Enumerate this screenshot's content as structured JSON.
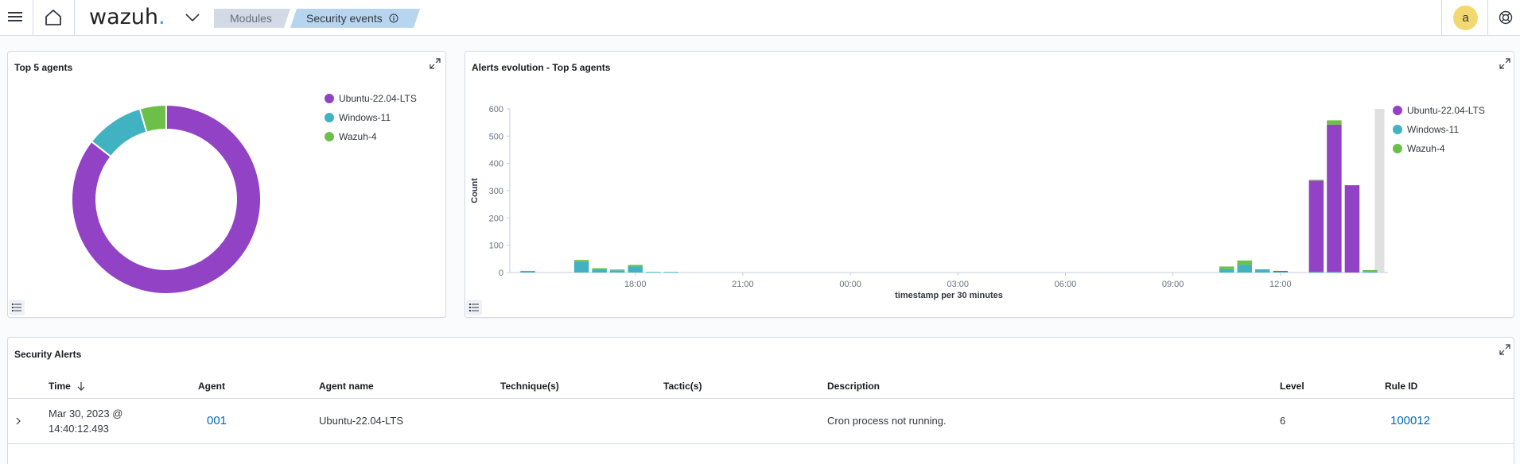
{
  "header": {
    "logo_text": "wazuh",
    "logo_dot": ".",
    "breadcrumb_modules": "Modules",
    "breadcrumb_current": "Security events",
    "avatar_initial": "a"
  },
  "colors": {
    "ubuntu": "#9242c4",
    "windows": "#40b2c2",
    "wazuh": "#6cc04a"
  },
  "top_agents": {
    "title": "Top 5 agents",
    "legend": [
      "Ubuntu-22.04-LTS",
      "Windows-11",
      "Wazuh-4"
    ]
  },
  "alerts_evolution": {
    "title": "Alerts evolution - Top 5 agents",
    "legend": [
      "Ubuntu-22.04-LTS",
      "Windows-11",
      "Wazuh-4"
    ]
  },
  "chart_data": [
    {
      "type": "pie",
      "title": "Top 5 agents",
      "donut": true,
      "labels": [
        "Ubuntu-22.04-LTS",
        "Windows-11",
        "Wazuh-4"
      ],
      "values": [
        85.5,
        10,
        4.5
      ],
      "legend": "top-right"
    },
    {
      "type": "bar",
      "stacked": true,
      "title": "Alerts evolution - Top 5 agents",
      "xlabel": "timestamp per 30 minutes",
      "ylabel": "Count",
      "ylim": [
        0,
        600
      ],
      "yticks": [
        0,
        100,
        200,
        300,
        400,
        500,
        600
      ],
      "xtick_labels": [
        "18:00",
        "21:00",
        "00:00",
        "03:00",
        "06:00",
        "09:00",
        "12:00"
      ],
      "xtick_hours": [
        18,
        21,
        24,
        27,
        30,
        33,
        36
      ],
      "x_hours": [
        15.0,
        15.5,
        16.0,
        16.5,
        17.0,
        17.5,
        18.0,
        18.5,
        19.0,
        19.5,
        20.0,
        20.5,
        21.0,
        21.5,
        22.0,
        22.5,
        23.0,
        23.5,
        24.0,
        24.5,
        25.0,
        25.5,
        26.0,
        26.5,
        27.0,
        27.5,
        28.0,
        28.5,
        29.0,
        29.5,
        30.0,
        30.5,
        31.0,
        31.5,
        32.0,
        32.5,
        33.0,
        33.5,
        34.0,
        34.5,
        35.0,
        35.5,
        36.0,
        36.5,
        37.0,
        37.5,
        38.0,
        38.5
      ],
      "series": [
        {
          "name": "Ubuntu-22.04-LTS",
          "values": [
            0,
            0,
            0,
            0,
            0,
            0,
            0,
            0,
            0,
            0,
            0,
            0,
            0,
            0,
            0,
            0,
            0,
            0,
            0,
            0,
            0,
            0,
            0,
            0,
            0,
            0,
            0,
            0,
            0,
            0,
            0,
            0,
            0,
            0,
            0,
            0,
            0,
            0,
            0,
            0,
            0,
            0,
            2,
            0,
            335,
            540,
            320,
            0
          ]
        },
        {
          "name": "Windows-11",
          "values": [
            6,
            0,
            0,
            40,
            12,
            8,
            22,
            2,
            2,
            0,
            0,
            0,
            0,
            0,
            0,
            0,
            0,
            0,
            0,
            0,
            0,
            0,
            0,
            0,
            0,
            0,
            0,
            0,
            0,
            0,
            0,
            0,
            0,
            0,
            0,
            0,
            0,
            0,
            0,
            12,
            28,
            10,
            4,
            0,
            2,
            2,
            0,
            5
          ]
        },
        {
          "name": "Wazuh-4",
          "values": [
            0,
            0,
            0,
            6,
            4,
            3,
            6,
            0,
            0,
            0,
            0,
            0,
            0,
            0,
            0,
            0,
            0,
            0,
            0,
            0,
            0,
            0,
            0,
            0,
            0,
            0,
            0,
            0,
            0,
            0,
            0,
            0,
            0,
            0,
            0,
            0,
            0,
            0,
            0,
            10,
            16,
            2,
            0,
            0,
            3,
            16,
            0,
            4
          ]
        }
      ],
      "legend": "right"
    }
  ],
  "security_alerts": {
    "title": "Security Alerts",
    "columns": {
      "time": "Time",
      "agent": "Agent",
      "agent_name": "Agent name",
      "techniques": "Technique(s)",
      "tactics": "Tactic(s)",
      "description": "Description",
      "level": "Level",
      "rule_id": "Rule ID"
    },
    "rows": [
      {
        "time_line1": "Mar 30, 2023 @",
        "time_line2": "14:40:12.493",
        "agent": "001",
        "agent_name": "Ubuntu-22.04-LTS",
        "techniques": "",
        "tactics": "",
        "description": "Cron process not running.",
        "level": "6",
        "rule_id": "100012"
      }
    ]
  }
}
